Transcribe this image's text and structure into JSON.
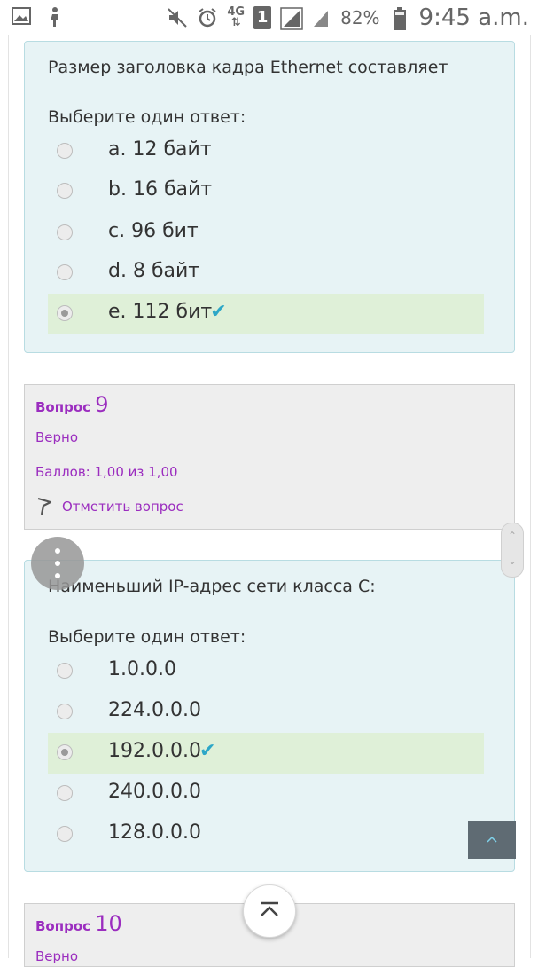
{
  "status_bar": {
    "sim_slot": "1",
    "network": "4G",
    "battery": "82%",
    "time": "9:45 a.m.",
    "icons": [
      "gallery-icon",
      "figure-icon",
      "mute-icon",
      "alarm-icon",
      "network-4g-icon",
      "sim-1-icon",
      "signal-icon",
      "signal-weak-icon",
      "battery-icon"
    ]
  },
  "question8": {
    "text": "Размер заголовка кадра Ethernet составляет",
    "prompt": "Выберите один ответ:",
    "options": [
      {
        "label": "a. 12 байт",
        "selected": false
      },
      {
        "label": "b. 16 байт",
        "selected": false
      },
      {
        "label": "c. 96 бит",
        "selected": false
      },
      {
        "label": "d. 8 байт",
        "selected": false
      },
      {
        "label": "e. 112 бит",
        "selected": true,
        "correct": true
      }
    ]
  },
  "question9_info": {
    "label": "Вопрос",
    "number": "9",
    "status": "Верно",
    "score": "Баллов: 1,00 из 1,00",
    "flag_label": "Отметить вопрос"
  },
  "question9": {
    "text": "Наименьший IP-адрес сети класса C:",
    "prompt": "Выберите один ответ:",
    "options": [
      {
        "label": "1.0.0.0",
        "selected": false
      },
      {
        "label": "224.0.0.0",
        "selected": false
      },
      {
        "label": "192.0.0.0",
        "selected": true,
        "correct": true
      },
      {
        "label": "240.0.0.0",
        "selected": false
      },
      {
        "label": "128.0.0.0",
        "selected": false
      }
    ]
  },
  "question10_info": {
    "label": "Вопрос",
    "number": "10",
    "status": "Верно"
  },
  "colors": {
    "card_bg": "#e7f3f5",
    "correct_bg": "#dff0d8",
    "check": "#2da7c7",
    "accent_text": "#9b2dbf"
  },
  "icons": {
    "check": "✔",
    "chevron_up": "⌃",
    "chevron_down": "⌄"
  }
}
